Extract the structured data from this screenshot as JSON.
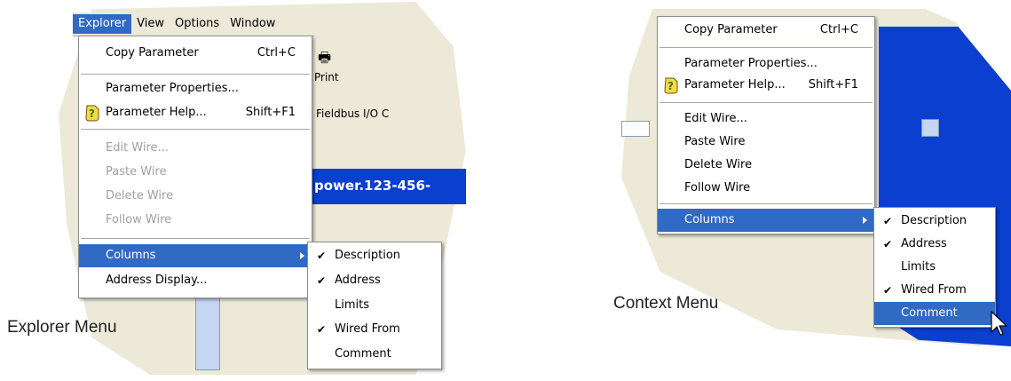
{
  "explorer_menu": {
    "caption": "Explorer Menu",
    "menubar": [
      "Explorer",
      "View",
      "Options",
      "Window"
    ],
    "items": [
      {
        "label": "Copy Parameter",
        "shortcut": "Ctrl+C"
      },
      {
        "label": "Parameter Properties..."
      },
      {
        "label": "Parameter Help...",
        "shortcut": "Shift+F1"
      },
      {
        "label": "Edit Wire..."
      },
      {
        "label": "Paste Wire"
      },
      {
        "label": "Delete Wire"
      },
      {
        "label": "Follow Wire"
      },
      {
        "label": "Columns"
      },
      {
        "label": "Address Display..."
      }
    ],
    "submenu": [
      "Description",
      "Address",
      "Limits",
      "Wired From",
      "Comment"
    ],
    "background": {
      "print": "Print",
      "fieldbus": "Fieldbus I/O C",
      "title": "power.123-456-"
    }
  },
  "context_menu": {
    "caption": "Context Menu",
    "items": [
      {
        "label": "Copy Parameter",
        "shortcut": "Ctrl+C"
      },
      {
        "label": "Parameter Properties..."
      },
      {
        "label": "Parameter Help...",
        "shortcut": "Shift+F1"
      },
      {
        "label": "Edit Wire..."
      },
      {
        "label": "Paste Wire"
      },
      {
        "label": "Delete Wire"
      },
      {
        "label": "Follow Wire"
      },
      {
        "label": "Columns"
      }
    ],
    "submenu": [
      "Description",
      "Address",
      "Limits",
      "Wired From",
      "Comment"
    ]
  },
  "colors": {
    "highlight": "#316ac5",
    "disabled": "#a0a0a0",
    "chrome": "#ece9d8",
    "blue_pane": "#0a3fd0"
  },
  "icons": [
    "help-icon",
    "submenu-arrow-icon",
    "check-icon",
    "printer-icon",
    "mouse-cursor-icon"
  ]
}
